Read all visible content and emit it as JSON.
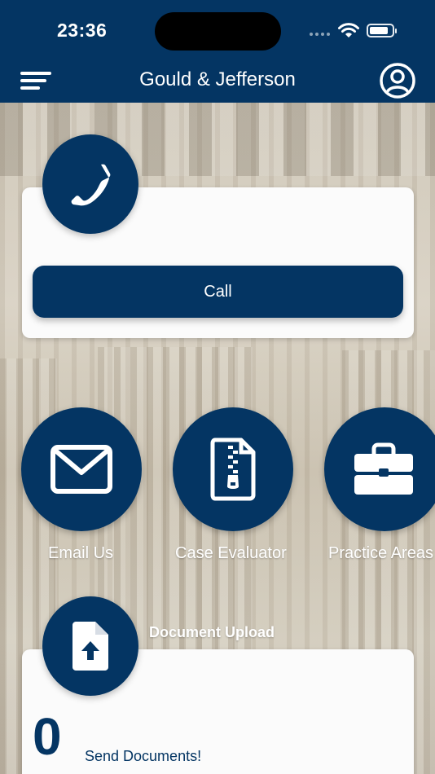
{
  "status_bar": {
    "time": "23:36"
  },
  "nav": {
    "title": "Gould & Jefferson",
    "menu_icon": "menu-icon",
    "profile_icon": "user-circle-icon"
  },
  "call_card": {
    "icon": "phone-icon",
    "button_label": "Call"
  },
  "tiles": [
    {
      "label": "Email Us",
      "icon": "envelope-icon"
    },
    {
      "label": "Case Evaluator",
      "icon": "zip-file-icon"
    },
    {
      "label": "Practice Areas",
      "icon": "briefcase-icon"
    }
  ],
  "document_upload": {
    "title": "Document Upload",
    "icon": "file-upload-icon",
    "count": "0",
    "send_label": "Send Documents!"
  },
  "colors": {
    "brand": "#043563",
    "card": "#fbfbfb"
  }
}
